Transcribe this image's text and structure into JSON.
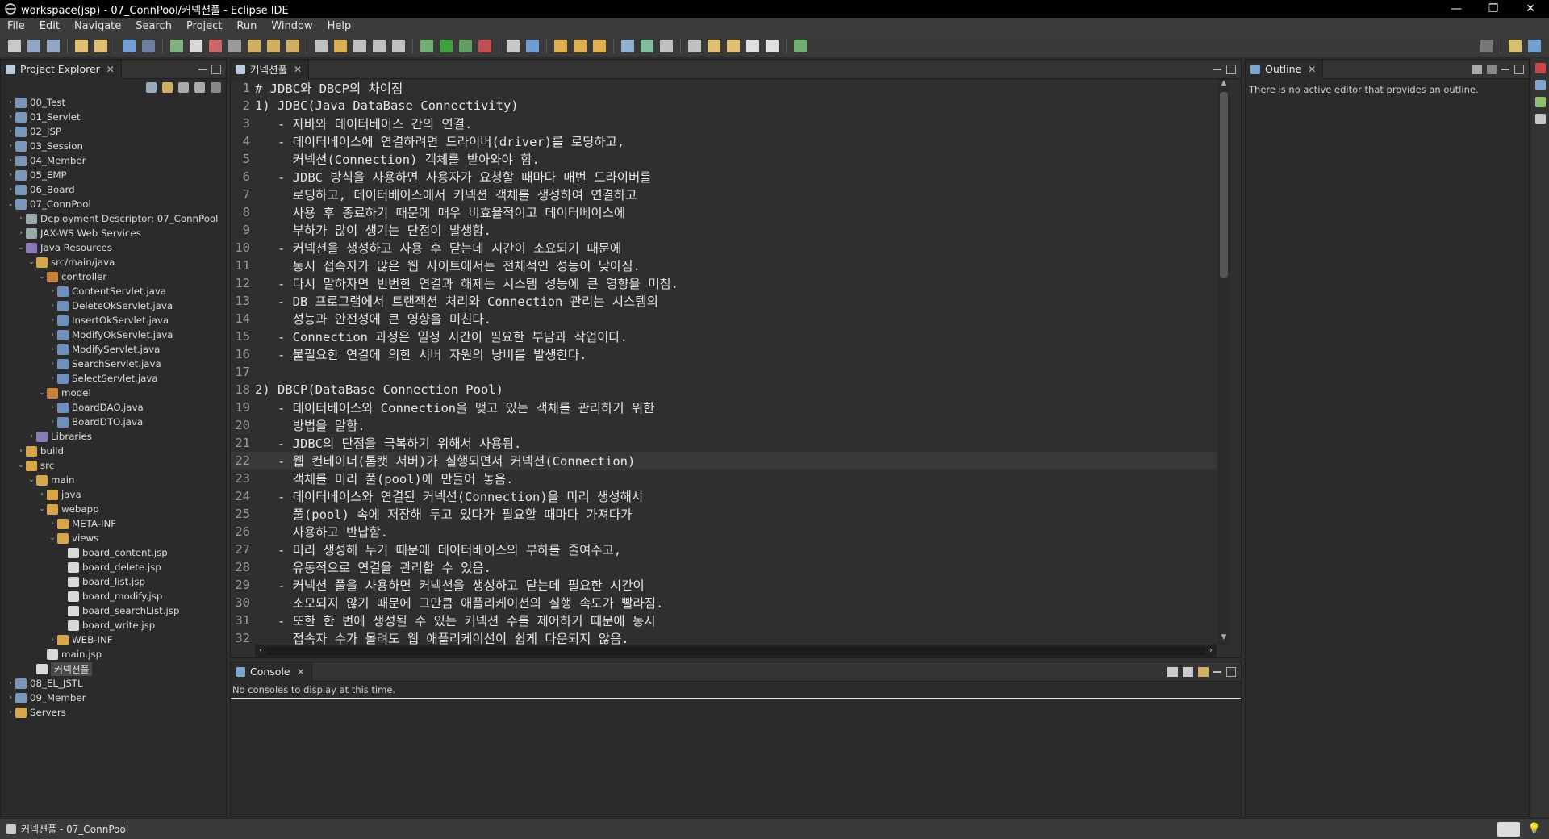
{
  "window": {
    "title": "workspace(jsp) - 07_ConnPool/커넥션풀 - Eclipse IDE"
  },
  "menu": [
    "File",
    "Edit",
    "Navigate",
    "Search",
    "Project",
    "Run",
    "Window",
    "Help"
  ],
  "colors": {
    "background": "#2f2f2f",
    "panel": "#2b2b2b",
    "text": "#dcdcdc",
    "lineNumbers": "#9a9a9a"
  },
  "project_explorer": {
    "title": "Project Explorer",
    "tree": [
      {
        "label": "00_Test",
        "icon": "project-icon",
        "arrow": "›"
      },
      {
        "label": "01_Servlet",
        "icon": "project-icon",
        "arrow": "›"
      },
      {
        "label": "02_JSP",
        "icon": "project-icon",
        "arrow": "›"
      },
      {
        "label": "03_Session",
        "icon": "project-icon",
        "arrow": "›"
      },
      {
        "label": "04_Member",
        "icon": "project-icon",
        "arrow": "›"
      },
      {
        "label": "05_EMP",
        "icon": "project-icon",
        "arrow": "›"
      },
      {
        "label": "06_Board",
        "icon": "project-icon",
        "arrow": "›"
      },
      {
        "label": "07_ConnPool",
        "icon": "project-icon",
        "arrow": "⌄"
      },
      {
        "label": "Deployment Descriptor: 07_ConnPool",
        "icon": "descriptor-icon",
        "arrow": "›"
      },
      {
        "label": "JAX-WS Web Services",
        "icon": "webservices-icon",
        "arrow": "›"
      },
      {
        "label": "Java Resources",
        "icon": "java-resources-icon",
        "arrow": "⌄"
      },
      {
        "label": "src/main/java",
        "icon": "source-folder-icon",
        "arrow": "⌄"
      },
      {
        "label": "controller",
        "icon": "package-icon",
        "arrow": "⌄"
      },
      {
        "label": "ContentServlet.java",
        "icon": "java-file-icon",
        "arrow": "›"
      },
      {
        "label": "DeleteOkServlet.java",
        "icon": "java-file-icon",
        "arrow": "›"
      },
      {
        "label": "InsertOkServlet.java",
        "icon": "java-file-icon",
        "arrow": "›"
      },
      {
        "label": "ModifyOkServlet.java",
        "icon": "java-file-icon",
        "arrow": "›"
      },
      {
        "label": "ModifyServlet.java",
        "icon": "java-file-icon",
        "arrow": "›"
      },
      {
        "label": "SearchServlet.java",
        "icon": "java-file-icon",
        "arrow": "›"
      },
      {
        "label": "SelectServlet.java",
        "icon": "java-file-icon",
        "arrow": "›"
      },
      {
        "label": "model",
        "icon": "package-icon",
        "arrow": "⌄"
      },
      {
        "label": "BoardDAO.java",
        "icon": "java-file-icon",
        "arrow": "›"
      },
      {
        "label": "BoardDTO.java",
        "icon": "java-file-icon",
        "arrow": "›"
      },
      {
        "label": "Libraries",
        "icon": "library-icon",
        "arrow": "›"
      },
      {
        "label": "build",
        "icon": "folder-icon",
        "arrow": "›"
      },
      {
        "label": "src",
        "icon": "folder-icon",
        "arrow": "⌄"
      },
      {
        "label": "main",
        "icon": "folder-icon",
        "arrow": "⌄"
      },
      {
        "label": "java",
        "icon": "folder-icon",
        "arrow": "›"
      },
      {
        "label": "webapp",
        "icon": "folder-icon",
        "arrow": "⌄"
      },
      {
        "label": "META-INF",
        "icon": "folder-icon",
        "arrow": "›"
      },
      {
        "label": "views",
        "icon": "folder-icon",
        "arrow": "⌄"
      },
      {
        "label": "board_content.jsp",
        "icon": "jsp-file-icon",
        "arrow": ""
      },
      {
        "label": "board_delete.jsp",
        "icon": "jsp-file-icon",
        "arrow": ""
      },
      {
        "label": "board_list.jsp",
        "icon": "jsp-file-icon",
        "arrow": ""
      },
      {
        "label": "board_modify.jsp",
        "icon": "jsp-file-icon",
        "arrow": ""
      },
      {
        "label": "board_searchList.jsp",
        "icon": "jsp-file-icon",
        "arrow": ""
      },
      {
        "label": "board_write.jsp",
        "icon": "jsp-file-icon",
        "arrow": ""
      },
      {
        "label": "WEB-INF",
        "icon": "folder-icon",
        "arrow": "›"
      },
      {
        "label": "main.jsp",
        "icon": "jsp-file-icon",
        "arrow": ""
      },
      {
        "label": "커넥션풀",
        "icon": "text-file-icon",
        "arrow": ""
      },
      {
        "label": "08_EL_JSTL",
        "icon": "project-icon",
        "arrow": "›"
      },
      {
        "label": "09_Member",
        "icon": "project-icon",
        "arrow": "›"
      },
      {
        "label": "Servers",
        "icon": "folder-icon",
        "arrow": "›"
      }
    ]
  },
  "editor": {
    "tab": "커넥션풀",
    "lines": [
      "# JDBC와 DBCP의 차이점",
      "1) JDBC(Java DataBase Connectivity)",
      "   - 자바와 데이터베이스 간의 연결.",
      "   - 데이터베이스에 연결하려면 드라이버(driver)를 로딩하고,",
      "     커넥션(Connection) 객체를 받아와야 함.",
      "   - JDBC 방식을 사용하면 사용자가 요청할 때마다 매번 드라이버를",
      "     로딩하고, 데이터베이스에서 커넥션 객체를 생성하여 연결하고",
      "     사용 후 종료하기 때문에 매우 비효율적이고 데이터베이스에",
      "     부하가 많이 생기는 단점이 발생함.",
      "   - 커넥션을 생성하고 사용 후 닫는데 시간이 소요되기 때문에",
      "     동시 접속자가 많은 웹 사이트에서는 전체적인 성능이 낮아짐.",
      "   - 다시 말하자면 빈번한 연결과 해제는 시스템 성능에 큰 영향을 미침.",
      "   - DB 프로그램에서 트랜잭션 처리와 Connection 관리는 시스템의",
      "     성능과 안전성에 큰 영향을 미친다.",
      "   - Connection 과정은 일정 시간이 필요한 부담과 작업이다.",
      "   - 불필요한 연결에 의한 서버 자원의 낭비를 발생한다.",
      "",
      "2) DBCP(DataBase Connection Pool)",
      "   - 데이터베이스와 Connection을 맺고 있는 객체를 관리하기 위한",
      "     방법을 말함.",
      "   - JDBC의 단점을 극복하기 위해서 사용됨.",
      "   - 웹 컨테이너(톰캣 서버)가 실행되면서 커넥션(Connection)",
      "     객체를 미리 풀(pool)에 만들어 놓음.",
      "   - 데이터베이스와 연결된 커넥션(Connection)을 미리 생성해서",
      "     풀(pool) 속에 저장해 두고 있다가 필요할 때마다 가져다가",
      "     사용하고 반납함.",
      "   - 미리 생성해 두기 때문에 데이터베이스의 부하를 줄여주고,",
      "     유동적으로 연결을 관리할 수 있음.",
      "   - 커넥션 풀을 사용하면 커넥션을 생성하고 닫는데 필요한 시간이",
      "     소모되지 않기 때문에 그만큼 애플리케이션의 실행 속도가 빨라짐.",
      "   - 또한 한 번에 생성될 수 있는 커넥션 수를 제어하기 때문에 동시",
      "     접속자 수가 몰려도 웹 애플리케이션이 쉽게 다운되지 않음."
    ],
    "line_numbers": [
      "1",
      "2",
      "3",
      "4",
      "5",
      "6",
      "7",
      "8",
      "9",
      "10",
      "11",
      "12",
      "13",
      "14",
      "15",
      "16",
      "17",
      "18",
      "19",
      "20",
      "21",
      "22",
      "23",
      "24",
      "25",
      "26",
      "27",
      "28",
      "29",
      "30",
      "31",
      "32"
    ],
    "current_line": 22
  },
  "outline": {
    "title": "Outline",
    "message": "There is no active editor that provides an outline."
  },
  "console": {
    "title": "Console",
    "message": "No consoles to display at this time."
  },
  "status": {
    "text": "커넥션풀 - 07_ConnPool"
  }
}
